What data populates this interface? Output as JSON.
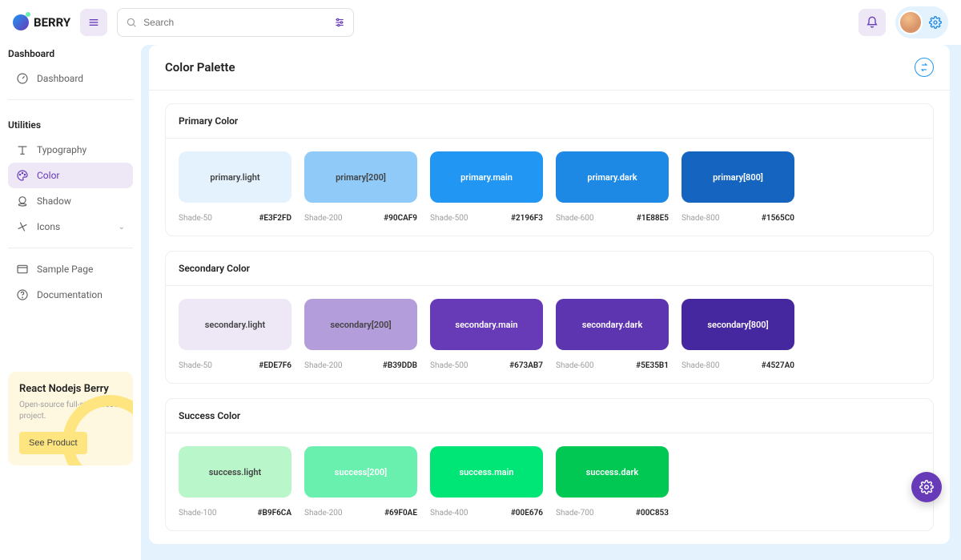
{
  "app": {
    "name": "BERRY"
  },
  "search": {
    "placeholder": "Search"
  },
  "sidebar": {
    "sections": [
      {
        "title": "Dashboard",
        "items": [
          {
            "icon": "speedometer",
            "label": "Dashboard"
          }
        ]
      },
      {
        "title": "Utilities",
        "items": [
          {
            "icon": "typography",
            "label": "Typography"
          },
          {
            "icon": "palette",
            "label": "Color",
            "active": true
          },
          {
            "icon": "shadow",
            "label": "Shadow"
          },
          {
            "icon": "windmill",
            "label": "Icons",
            "expandable": true
          }
        ]
      }
    ],
    "extras": [
      {
        "icon": "browser",
        "label": "Sample Page"
      },
      {
        "icon": "help",
        "label": "Documentation"
      }
    ]
  },
  "promo": {
    "title": "React Nodejs Berry",
    "subtitle": "Open-source full-stack seed project.",
    "cta": "See Product"
  },
  "page": {
    "title": "Color Palette"
  },
  "palette": [
    {
      "title": "Primary Color",
      "swatches": [
        {
          "label": "primary.light",
          "shade": "Shade-50",
          "hex": "#E3F2FD",
          "bg": "#E3F2FD",
          "text": "light"
        },
        {
          "label": "primary[200]",
          "shade": "Shade-200",
          "hex": "#90CAF9",
          "bg": "#90CAF9",
          "text": "light"
        },
        {
          "label": "primary.main",
          "shade": "Shade-500",
          "hex": "#2196F3",
          "bg": "#2196F3",
          "text": "dark"
        },
        {
          "label": "primary.dark",
          "shade": "Shade-600",
          "hex": "#1E88E5",
          "bg": "#1E88E5",
          "text": "dark"
        },
        {
          "label": "primary[800]",
          "shade": "Shade-800",
          "hex": "#1565C0",
          "bg": "#1565C0",
          "text": "dark"
        }
      ]
    },
    {
      "title": "Secondary Color",
      "swatches": [
        {
          "label": "secondary.light",
          "shade": "Shade-50",
          "hex": "#EDE7F6",
          "bg": "#EDE7F6",
          "text": "light"
        },
        {
          "label": "secondary[200]",
          "shade": "Shade-200",
          "hex": "#B39DDB",
          "bg": "#B39DDB",
          "text": "light"
        },
        {
          "label": "secondary.main",
          "shade": "Shade-500",
          "hex": "#673AB7",
          "bg": "#673AB7",
          "text": "dark"
        },
        {
          "label": "secondary.dark",
          "shade": "Shade-600",
          "hex": "#5E35B1",
          "bg": "#5E35B1",
          "text": "dark"
        },
        {
          "label": "secondary[800]",
          "shade": "Shade-800",
          "hex": "#4527A0",
          "bg": "#4527A0",
          "text": "dark"
        }
      ]
    },
    {
      "title": "Success Color",
      "swatches": [
        {
          "label": "success.light",
          "shade": "Shade-100",
          "hex": "#B9F6CA",
          "bg": "#B9F6CA",
          "text": "light"
        },
        {
          "label": "success[200]",
          "shade": "Shade-200",
          "hex": "#69F0AE",
          "bg": "#69F0AE",
          "text": "dark"
        },
        {
          "label": "success.main",
          "shade": "Shade-400",
          "hex": "#00E676",
          "bg": "#00E676",
          "text": "dark"
        },
        {
          "label": "success.dark",
          "shade": "Shade-700",
          "hex": "#00C853",
          "bg": "#00C853",
          "text": "dark"
        }
      ]
    }
  ]
}
